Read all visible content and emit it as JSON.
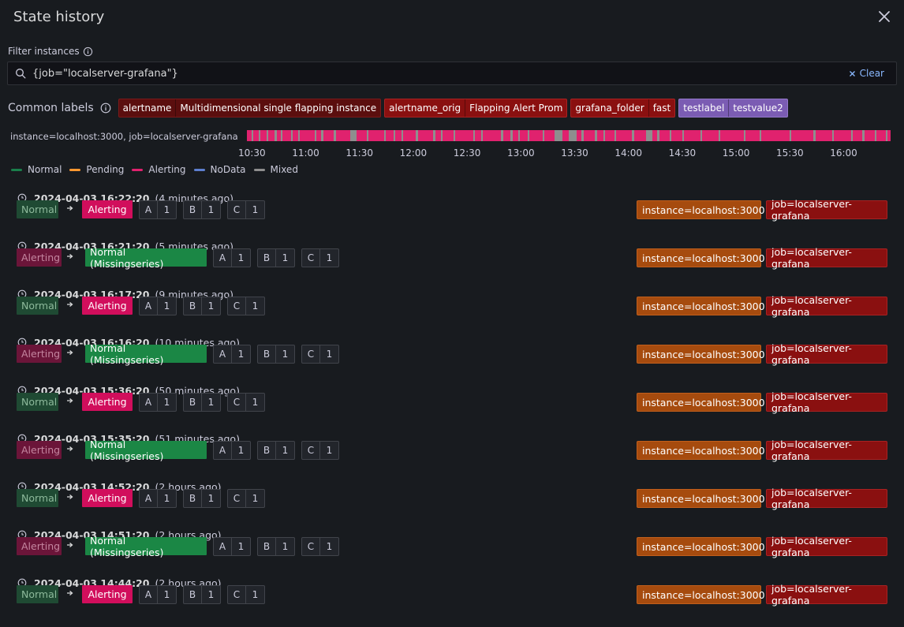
{
  "header": {
    "title": "State history"
  },
  "filter": {
    "label": "Filter instances",
    "value": "{job=\"localserver-grafana\"}",
    "clear_label": "Clear"
  },
  "common_labels": {
    "label": "Common labels",
    "items": [
      {
        "key": "alertname",
        "value": "Multidimensional single flapping instance",
        "bg": "#5b0e0e",
        "border": "#7a1a1a"
      },
      {
        "key": "alertname_orig",
        "value": "Flapping Alert Prom",
        "bg": "#8a1010",
        "border": "#a82222"
      },
      {
        "key": "grafana_folder",
        "value": "fast",
        "bg": "#8a1010",
        "border": "#a82222"
      },
      {
        "key": "testlabel",
        "value": "testvalue2",
        "bg": "#7b5cb3",
        "border": "#9479c9"
      }
    ]
  },
  "timeline": {
    "label": "instance=localhost:3000, job=localserver-grafana",
    "ticks": [
      "10:30",
      "11:00",
      "11:30",
      "12:00",
      "12:30",
      "13:00",
      "13:30",
      "14:00",
      "14:30",
      "15:00",
      "15:30",
      "16:00"
    ]
  },
  "legend": [
    {
      "label": "Normal",
      "color": "#1a7f4b"
    },
    {
      "label": "Pending",
      "color": "#ff9830"
    },
    {
      "label": "Alerting",
      "color": "#e0226e"
    },
    {
      "label": "NoData",
      "color": "#5d7fcf"
    },
    {
      "label": "Mixed",
      "color": "#8e8e8e"
    }
  ],
  "queries": [
    {
      "key": "A",
      "value": "1"
    },
    {
      "key": "B",
      "value": "1"
    },
    {
      "key": "C",
      "value": "1"
    }
  ],
  "row_labels": {
    "instance": "instance=localhost:3000",
    "job": "job=localserver-grafana"
  },
  "rows": [
    {
      "timestamp": "2024-04-03 16:22:20",
      "ago": "(4 minutes ago)",
      "from": "Normal",
      "to": "Alerting"
    },
    {
      "timestamp": "2024-04-03 16:21:20",
      "ago": "(5 minutes ago)",
      "from": "Alerting",
      "to": "Normal (Missingseries)"
    },
    {
      "timestamp": "2024-04-03 16:17:20",
      "ago": "(9 minutes ago)",
      "from": "Normal",
      "to": "Alerting"
    },
    {
      "timestamp": "2024-04-03 16:16:20",
      "ago": "(10 minutes ago)",
      "from": "Alerting",
      "to": "Normal (Missingseries)"
    },
    {
      "timestamp": "2024-04-03 15:36:20",
      "ago": "(50 minutes ago)",
      "from": "Normal",
      "to": "Alerting"
    },
    {
      "timestamp": "2024-04-03 15:35:20",
      "ago": "(51 minutes ago)",
      "from": "Alerting",
      "to": "Normal (Missingseries)"
    },
    {
      "timestamp": "2024-04-03 14:52:20",
      "ago": "(2 hours ago)",
      "from": "Normal",
      "to": "Alerting"
    },
    {
      "timestamp": "2024-04-03 14:51:20",
      "ago": "(2 hours ago)",
      "from": "Alerting",
      "to": "Normal (Missingseries)"
    },
    {
      "timestamp": "2024-04-03 14:44:20",
      "ago": "(2 hours ago)",
      "from": "Normal",
      "to": "Alerting"
    }
  ]
}
